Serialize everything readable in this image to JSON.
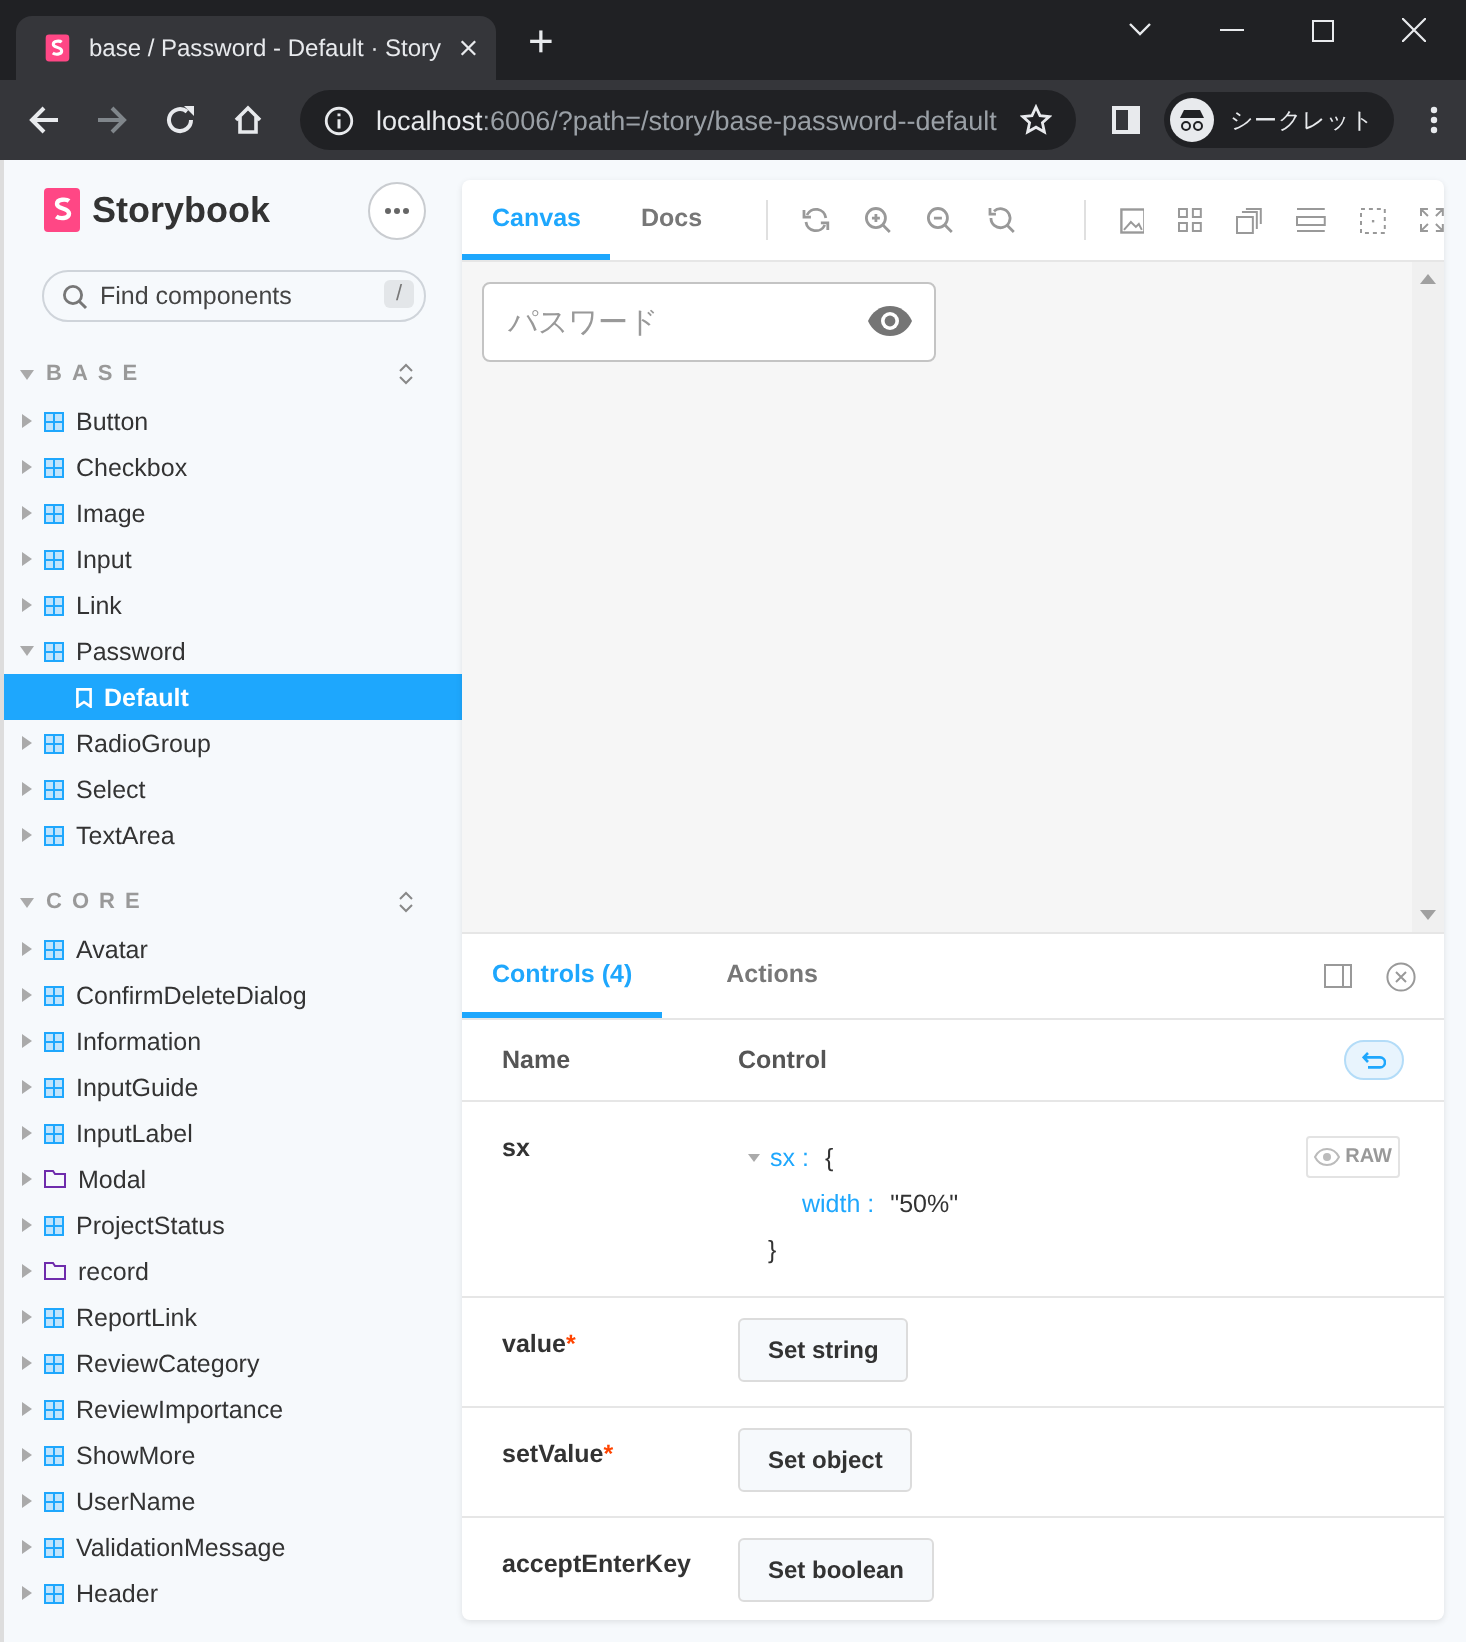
{
  "browser": {
    "tab_title": "base / Password - Default · Story",
    "new_tab": "+",
    "url_host": "localhost",
    "url_rest": ":6006/?path=/story/base-password--default",
    "profile": "シークレット"
  },
  "sidebar": {
    "brand": "Storybook",
    "search": {
      "placeholder": "Find components",
      "shortcut": "/"
    },
    "groups": [
      {
        "label": "BASE",
        "expanded": true,
        "items": [
          {
            "label": "Button",
            "kind": "component",
            "expanded": false,
            "selected": false
          },
          {
            "label": "Checkbox",
            "kind": "component",
            "expanded": false,
            "selected": false
          },
          {
            "label": "Image",
            "kind": "component",
            "expanded": false,
            "selected": false
          },
          {
            "label": "Input",
            "kind": "component",
            "expanded": false,
            "selected": false
          },
          {
            "label": "Link",
            "kind": "component",
            "expanded": false,
            "selected": false
          },
          {
            "label": "Password",
            "kind": "component",
            "expanded": true,
            "selected": false,
            "children": [
              {
                "label": "Default",
                "kind": "story",
                "selected": true
              }
            ]
          },
          {
            "label": "RadioGroup",
            "kind": "component",
            "expanded": false,
            "selected": false
          },
          {
            "label": "Select",
            "kind": "component",
            "expanded": false,
            "selected": false
          },
          {
            "label": "TextArea",
            "kind": "component",
            "expanded": false,
            "selected": false
          }
        ]
      },
      {
        "label": "CORE",
        "expanded": true,
        "items": [
          {
            "label": "Avatar",
            "kind": "component",
            "expanded": false,
            "selected": false
          },
          {
            "label": "ConfirmDeleteDialog",
            "kind": "component",
            "expanded": false,
            "selected": false
          },
          {
            "label": "Information",
            "kind": "component",
            "expanded": false,
            "selected": false
          },
          {
            "label": "InputGuide",
            "kind": "component",
            "expanded": false,
            "selected": false
          },
          {
            "label": "InputLabel",
            "kind": "component",
            "expanded": false,
            "selected": false
          },
          {
            "label": "Modal",
            "kind": "folder",
            "expanded": false,
            "selected": false
          },
          {
            "label": "ProjectStatus",
            "kind": "component",
            "expanded": false,
            "selected": false
          },
          {
            "label": "record",
            "kind": "folder",
            "expanded": false,
            "selected": false
          },
          {
            "label": "ReportLink",
            "kind": "component",
            "expanded": false,
            "selected": false
          },
          {
            "label": "ReviewCategory",
            "kind": "component",
            "expanded": false,
            "selected": false
          },
          {
            "label": "ReviewImportance",
            "kind": "component",
            "expanded": false,
            "selected": false
          },
          {
            "label": "ShowMore",
            "kind": "component",
            "expanded": false,
            "selected": false
          },
          {
            "label": "UserName",
            "kind": "component",
            "expanded": false,
            "selected": false
          },
          {
            "label": "ValidationMessage",
            "kind": "component",
            "expanded": false,
            "selected": false
          },
          {
            "label": "Header",
            "kind": "component",
            "expanded": false,
            "selected": false
          }
        ]
      }
    ]
  },
  "canvas": {
    "tabs": [
      {
        "label": "Canvas",
        "selected": true
      },
      {
        "label": "Docs",
        "selected": false
      }
    ],
    "password_field": {
      "placeholder": "パスワード"
    }
  },
  "addons": {
    "tabs": [
      {
        "label": "Controls (4)",
        "selected": true
      },
      {
        "label": "Actions",
        "selected": false
      }
    ],
    "columns": [
      "Name",
      "Control"
    ],
    "required_mark": "*",
    "rows": [
      {
        "name": "sx",
        "required": false,
        "kind": "object",
        "key": "sx",
        "separator": ":",
        "open": "{",
        "entries": [
          {
            "key": "width",
            "separator": ":",
            "value": "\"50%\""
          }
        ],
        "close": "}",
        "raw": "RAW"
      },
      {
        "name": "value",
        "required": true,
        "kind": "button",
        "button": "Set string"
      },
      {
        "name": "setValue",
        "required": true,
        "kind": "button",
        "button": "Set object"
      },
      {
        "name": "acceptEnterKey",
        "required": false,
        "kind": "button",
        "button": "Set boolean"
      }
    ]
  }
}
